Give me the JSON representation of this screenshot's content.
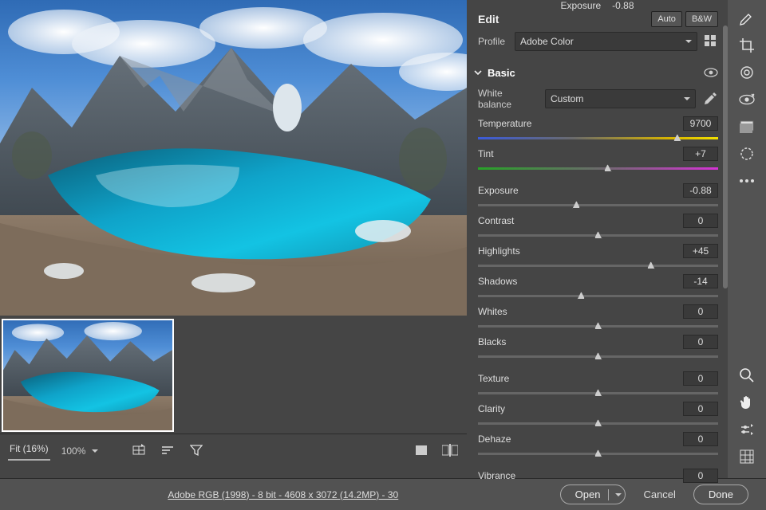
{
  "topstrip": {
    "param": "Exposure",
    "value": "-0.88"
  },
  "panel": {
    "title": "Edit",
    "auto": "Auto",
    "bw": "B&W",
    "profile_label": "Profile",
    "profile_value": "Adobe Color",
    "section": "Basic",
    "wb_label": "White balance",
    "wb_value": "Custom"
  },
  "sliders": {
    "temperature": {
      "label": "Temperature",
      "value": "9700",
      "pos": 83
    },
    "tint": {
      "label": "Tint",
      "value": "+7",
      "pos": 54
    },
    "exposure": {
      "label": "Exposure",
      "value": "-0.88",
      "pos": 41
    },
    "contrast": {
      "label": "Contrast",
      "value": "0",
      "pos": 50
    },
    "highlights": {
      "label": "Highlights",
      "value": "+45",
      "pos": 72
    },
    "shadows": {
      "label": "Shadows",
      "value": "-14",
      "pos": 43
    },
    "whites": {
      "label": "Whites",
      "value": "0",
      "pos": 50
    },
    "blacks": {
      "label": "Blacks",
      "value": "0",
      "pos": 50
    },
    "texture": {
      "label": "Texture",
      "value": "0",
      "pos": 50
    },
    "clarity": {
      "label": "Clarity",
      "value": "0",
      "pos": 50
    },
    "dehaze": {
      "label": "Dehaze",
      "value": "0",
      "pos": 50
    },
    "vibrance": {
      "label": "Vibrance",
      "value": "0",
      "pos": 50
    }
  },
  "bottombar": {
    "fit": "Fit (16%)",
    "pct": "100%"
  },
  "footer": {
    "meta": "Adobe RGB (1998) - 8 bit - 4608 x 3072 (14.2MP) - 30",
    "open": "Open",
    "cancel": "Cancel",
    "done": "Done"
  }
}
